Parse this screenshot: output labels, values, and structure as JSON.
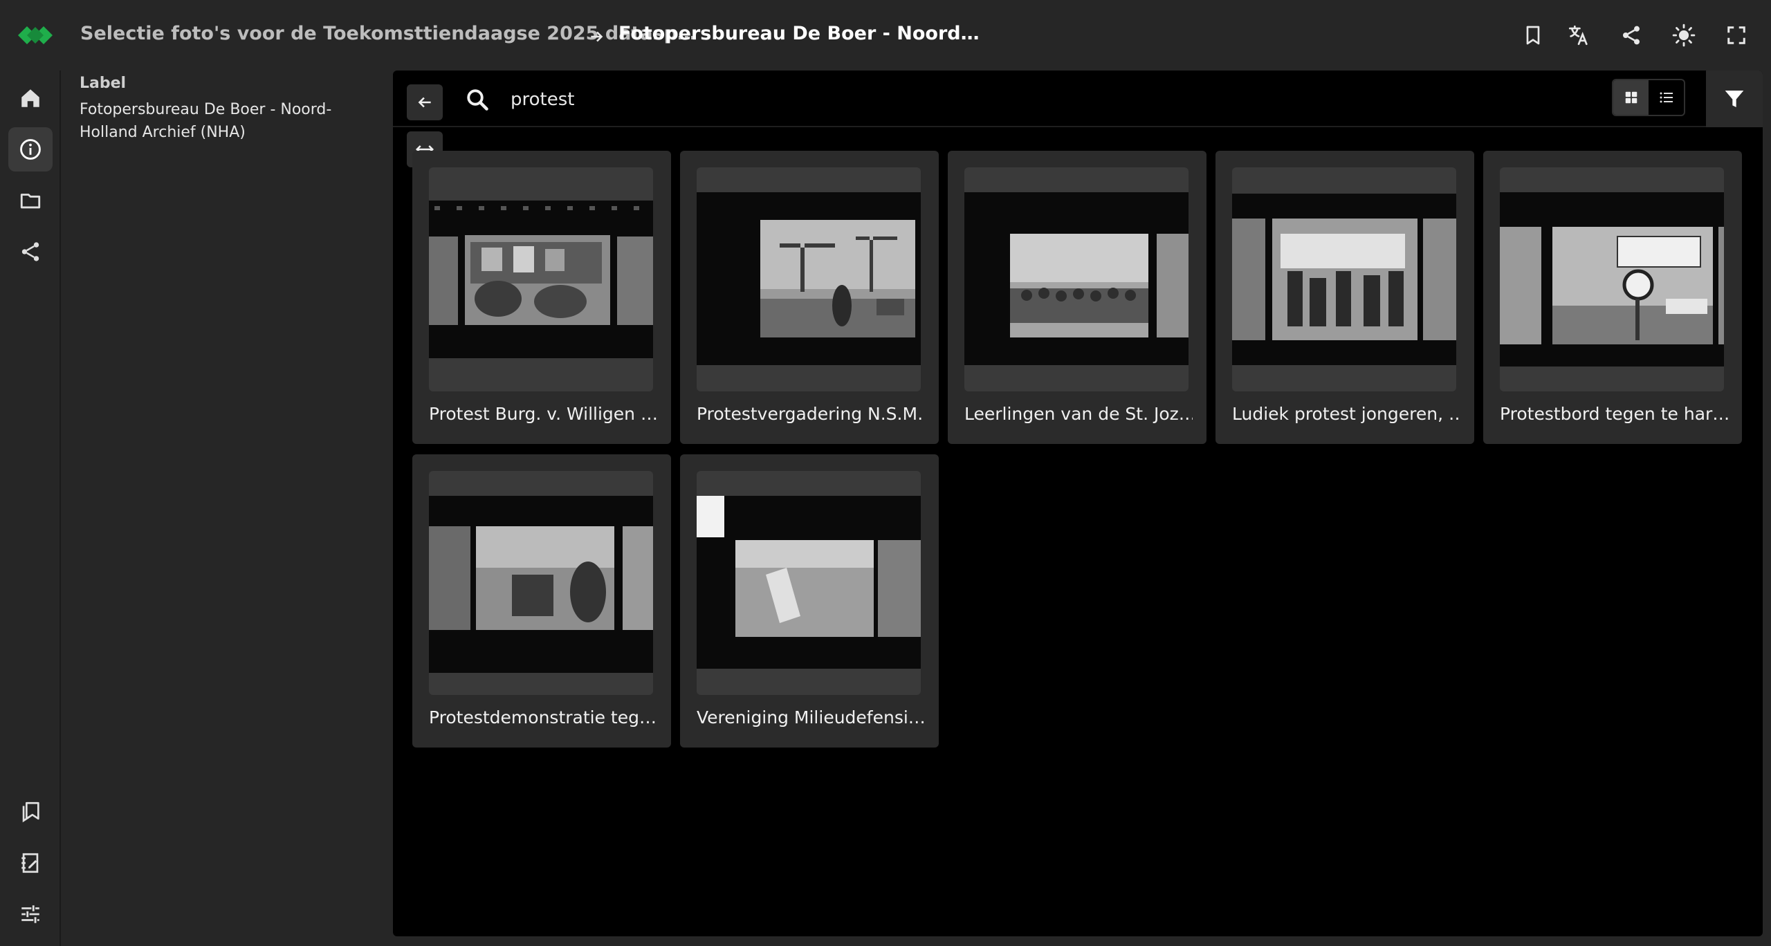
{
  "header": {
    "parent_title": "Selectie foto's voor de Toekomsttiendaagse 2025 datasp…",
    "current_title": "Fotopersbureau De Boer - Noord…"
  },
  "info": {
    "label": "Label",
    "value": "Fotopersbureau De Boer - Noord-Holland Archief (NHA)"
  },
  "search": {
    "query": "protest"
  },
  "cards": [
    {
      "title": "Protest Burg. v. Willigen …"
    },
    {
      "title": "Protestvergadering N.S.M…"
    },
    {
      "title": "Leerlingen van de St. Joz…"
    },
    {
      "title": "Ludiek protest jongeren, …"
    },
    {
      "title": "Protestbord tegen te har…"
    },
    {
      "title": "Protestdemonstratie teg…"
    },
    {
      "title": "Vereniging Milieudefensi…"
    }
  ],
  "colors": {
    "brand_green": "#1fae4b",
    "background": "#262626",
    "main_background": "#000000",
    "card_background": "#2b2b2b"
  },
  "icons": {
    "rail_top": [
      "home-icon",
      "info-icon",
      "folder-icon",
      "share-icon"
    ],
    "rail_bottom": [
      "bookmarks-icon",
      "notebook-icon",
      "settings-sliders-icon"
    ],
    "top_actions": [
      "bookmark-icon",
      "translate-icon",
      "share-icon",
      "brightness-icon",
      "fullscreen-icon"
    ]
  }
}
